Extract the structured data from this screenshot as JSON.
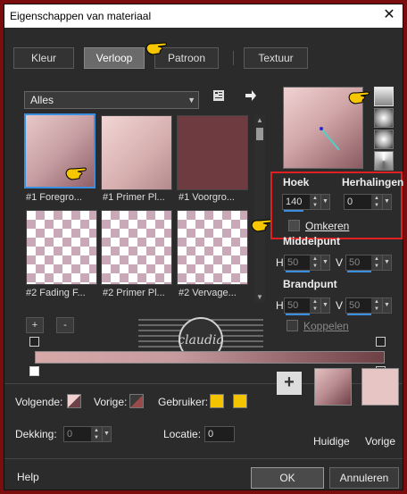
{
  "window": {
    "title": "Eigenschappen van materiaal",
    "close_glyph": "✕"
  },
  "tabs": [
    {
      "label": "Kleur"
    },
    {
      "label": "Verloop"
    },
    {
      "label": "Patroon"
    },
    {
      "label": "Textuur"
    }
  ],
  "library": {
    "filter_value": "Alles",
    "thumbnails": [
      {
        "caption": "#1 Foregro..."
      },
      {
        "caption": "#1 Primer Pl..."
      },
      {
        "caption": "#1 Voorgro..."
      },
      {
        "caption": "#2 Fading F..."
      },
      {
        "caption": "#2 Primer Pl..."
      },
      {
        "caption": "#2 Vervage..."
      }
    ],
    "add_label": "+",
    "remove_label": "-"
  },
  "settings": {
    "hoek_label": "Hoek",
    "hoek_value": "140",
    "herhalingen_label": "Herhalingen",
    "herhalingen_value": "0",
    "omkeren_label": "Omkeren",
    "middelpunt_label": "Middelpunt",
    "middelpunt_h_label": "H",
    "middelpunt_h_value": "50",
    "middelpunt_v_label": "V",
    "middelpunt_v_value": "50",
    "brandpunt_label": "Brandpunt",
    "brandpunt_h_label": "H",
    "brandpunt_h_value": "50",
    "brandpunt_v_label": "V",
    "brandpunt_v_value": "50",
    "koppelen_label": "Koppelen"
  },
  "watermark": {
    "text": "claudia"
  },
  "footer": {
    "volgende_label": "Volgende:",
    "vorige_label": "Vorige:",
    "gebruiker_label": "Gebruiker:",
    "dekking_label": "Dekking:",
    "dekking_value": "0",
    "locatie_label": "Locatie:",
    "locatie_value": "0",
    "huidige_label": "Huidige",
    "vorige_swatch_label": "Vorige",
    "help_label": "Help",
    "ok_label": "OK",
    "cancel_label": "Annuleren"
  },
  "colors": {
    "selection_blue": "#3b8fe0",
    "highlight_red": "#e02020",
    "gebruiker_yellow": "#f5c400",
    "huidige_top": "#c99ea2",
    "huidige_bottom": "#6e4148",
    "vorige_swatch": "#e6c5c4"
  }
}
